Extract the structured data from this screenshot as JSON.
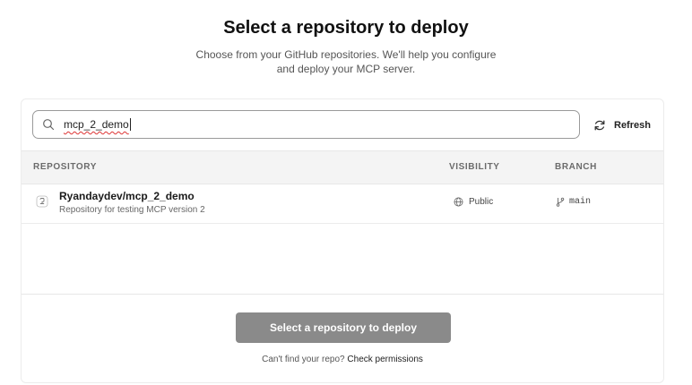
{
  "header": {
    "title": "Select a repository to deploy",
    "subtitle_line1": "Choose from your GitHub repositories. We'll help you configure",
    "subtitle_line2": "and deploy your MCP server."
  },
  "search": {
    "value": "mcp_2_demo",
    "icon": "search-icon"
  },
  "refresh": {
    "label": "Refresh",
    "icon": "refresh-icon"
  },
  "table": {
    "columns": [
      "REPOSITORY",
      "VISIBILITY",
      "BRANCH"
    ],
    "rows": [
      {
        "name": "Ryandaydev/mcp_2_demo",
        "description": "Repository for testing MCP version 2",
        "visibility": "Public",
        "branch": "main",
        "icon": "github-icon"
      }
    ]
  },
  "footer": {
    "deploy_label": "Select a repository to deploy",
    "help_text": "Can't find your repo?",
    "help_link": "Check permissions"
  },
  "colors": {
    "button_disabled": "#8a8a8a",
    "header_bg": "#f4f4f4"
  }
}
